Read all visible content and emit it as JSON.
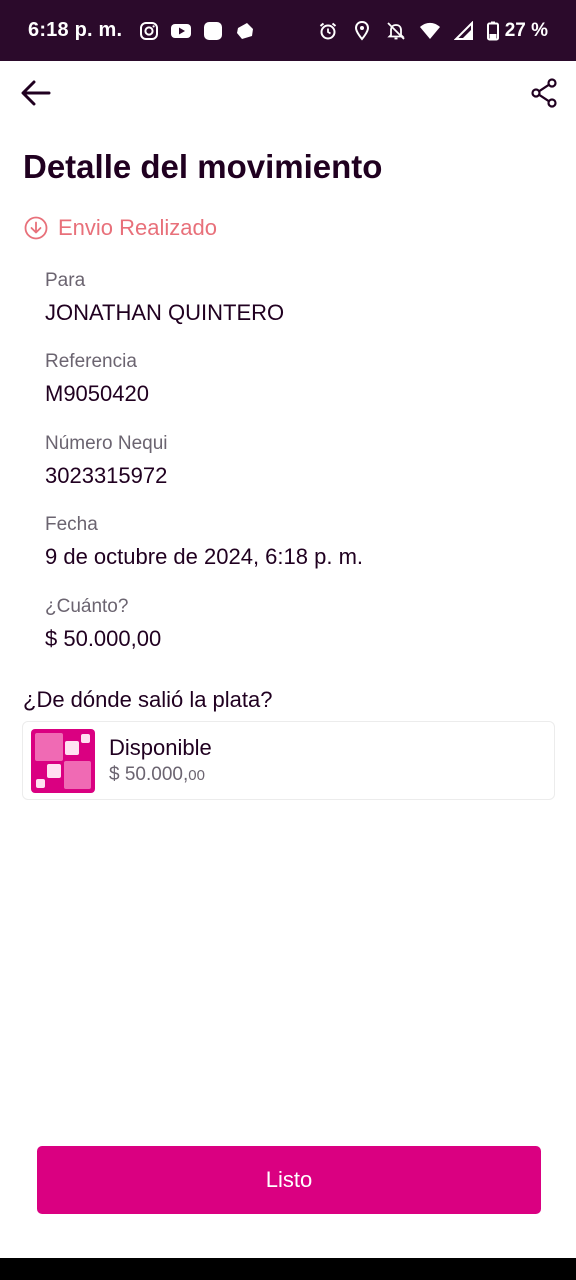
{
  "status_bar": {
    "time": "6:18 p. m.",
    "battery": "27 %",
    "icons_left": [
      "instagram-icon",
      "youtube-icon",
      "app-icon",
      "app-icon-2"
    ],
    "icons_right": [
      "alarm-icon",
      "location-icon",
      "mute-icon",
      "wifi-icon",
      "signal-icon",
      "battery-icon"
    ]
  },
  "header": {
    "title": "Detalle del movimiento",
    "back_icon": "back-arrow-icon",
    "share_icon": "share-icon"
  },
  "status": {
    "label": "Envio Realizado",
    "color": "#e8707a"
  },
  "details": [
    {
      "label": "Para",
      "value": "JONATHAN QUINTERO"
    },
    {
      "label": "Referencia",
      "value": "M9050420"
    },
    {
      "label": "Número Nequi",
      "value": "3023315972"
    },
    {
      "label": "Fecha",
      "value": "9 de octubre de 2024, 6:18 p. m."
    },
    {
      "label": "¿Cuánto?",
      "value": "$ 50.000,00"
    }
  ],
  "source": {
    "question": "¿De dónde salió la plata?",
    "name": "Disponible",
    "amount_main": "$ 50.000,",
    "amount_cents": "00"
  },
  "done_button": "Listo",
  "colors": {
    "brand": "#da0081",
    "status_bar": "#2b0a2b",
    "text": "#200020"
  }
}
